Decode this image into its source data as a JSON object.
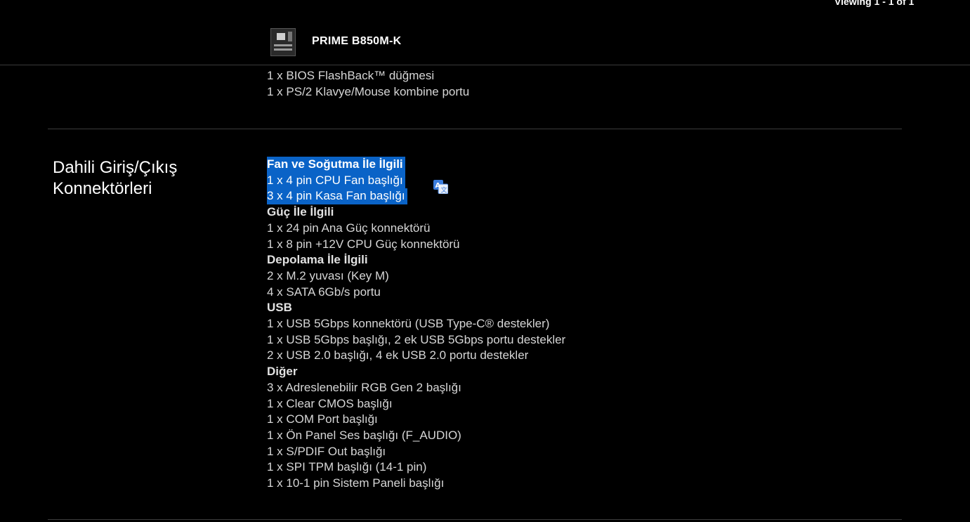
{
  "header": {
    "product_name": "PRIME B850M-K",
    "viewing": "Viewing 1 - 1 of 1"
  },
  "previous_section": {
    "items": [
      "1 x BIOS FlashBack™ düğmesi",
      "1 x PS/2 Klavye/Mouse kombine portu"
    ]
  },
  "section": {
    "title_line1": "Dahili Giriş/Çıkış",
    "title_line2": "Konnektörleri",
    "lines": [
      {
        "text": "Fan ve Soğutma İle İlgili",
        "bold": true,
        "selected": true
      },
      {
        "text": "1 x 4 pin CPU Fan başlığı",
        "bold": false,
        "selected": true
      },
      {
        "text": "3 x 4 pin Kasa Fan başlığı",
        "bold": false,
        "selected": true
      },
      {
        "text": "Güç İle İlgili",
        "bold": true,
        "selected": false
      },
      {
        "text": "1 x 24 pin Ana Güç konnektörü",
        "bold": false,
        "selected": false
      },
      {
        "text": "1 x 8 pin +12V CPU Güç konnektörü",
        "bold": false,
        "selected": false
      },
      {
        "text": "Depolama İle İlgili",
        "bold": true,
        "selected": false
      },
      {
        "text": "2 x M.2 yuvası (Key M)",
        "bold": false,
        "selected": false
      },
      {
        "text": "4 x SATA 6Gb/s portu",
        "bold": false,
        "selected": false
      },
      {
        "text": "USB",
        "bold": true,
        "selected": false
      },
      {
        "text": "1 x USB 5Gbps konnektörü (USB Type-C® destekler)",
        "bold": false,
        "selected": false
      },
      {
        "text": "1 x USB 5Gbps başlığı, 2 ek USB 5Gbps portu destekler",
        "bold": false,
        "selected": false
      },
      {
        "text": "2 x USB 2.0 başlığı, 4 ek USB 2.0 portu destekler",
        "bold": false,
        "selected": false
      },
      {
        "text": "Diğer",
        "bold": true,
        "selected": false
      },
      {
        "text": "3 x Adreslenebilir RGB Gen 2 başlığı",
        "bold": false,
        "selected": false
      },
      {
        "text": "1 x Clear CMOS başlığı",
        "bold": false,
        "selected": false
      },
      {
        "text": "1 x COM Port başlığı",
        "bold": false,
        "selected": false
      },
      {
        "text": "1 x Ön Panel Ses başlığı (F_AUDIO)",
        "bold": false,
        "selected": false
      },
      {
        "text": "1 x S/PDIF Out başlığı",
        "bold": false,
        "selected": false
      },
      {
        "text": "1 x SPI TPM başlığı (14-1 pin)",
        "bold": false,
        "selected": false
      },
      {
        "text": "1 x 10-1 pin Sistem Paneli başlığı",
        "bold": false,
        "selected": false
      }
    ]
  },
  "colors": {
    "background": "#000000",
    "text": "#d6d6d6",
    "selection": "#0a63c7",
    "translate_icon_blue": "#3b7ddd"
  },
  "icons": {
    "translate": "translate-icon",
    "product_thumbnail": "motherboard-thumbnail"
  }
}
